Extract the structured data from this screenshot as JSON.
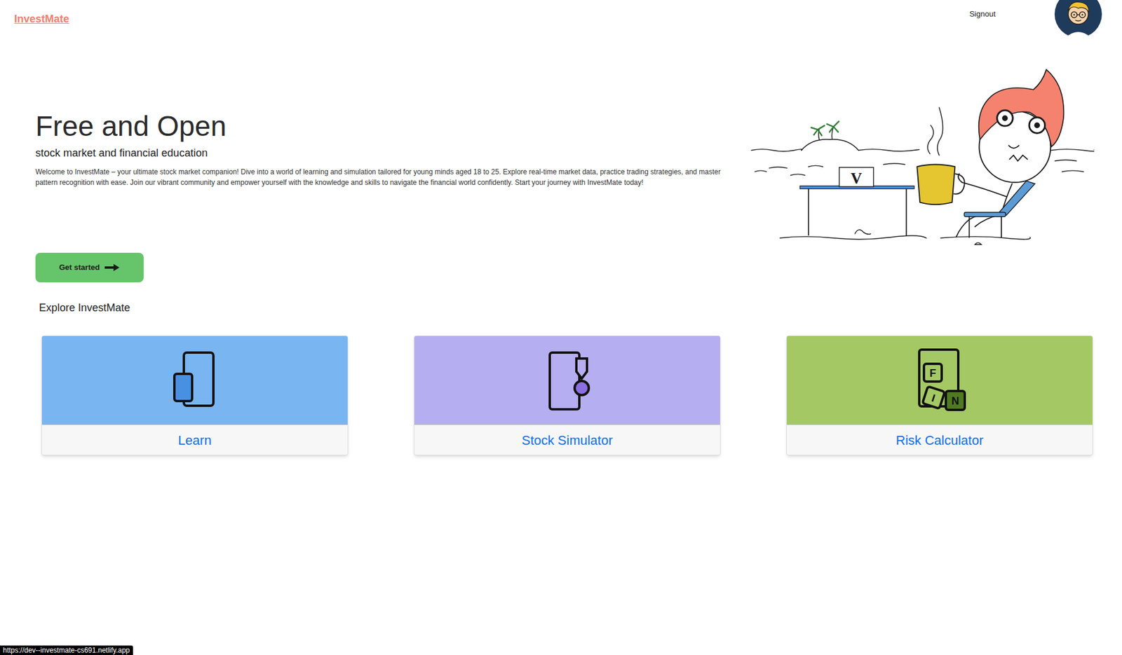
{
  "header": {
    "logo": "InvestMate",
    "signout": "Signout"
  },
  "hero": {
    "title": "Free and Open",
    "subtitle": "stock market and financial education",
    "description": "Welcome to InvestMate – your ultimate stock market companion! Dive into a world of learning and simulation tailored for young minds aged 18 to 25. Explore real-time market data, practice trading strategies, and master pattern recognition with ease. Join our vibrant community and empower yourself with the knowledge and skills to navigate the financial world confidently. Start your journey with InvestMate today!",
    "cta": "Get started",
    "illustration": {
      "laptop_letter": "V"
    }
  },
  "explore": {
    "title": "Explore InvestMate",
    "cards": [
      {
        "label": "Learn",
        "kind": "learn",
        "color": "#79b5f0"
      },
      {
        "label": "Stock Simulator",
        "kind": "simulator",
        "color": "#b5aef0"
      },
      {
        "label": "Risk Calculator",
        "kind": "calculator",
        "color": "#a4c964",
        "icon_letters": [
          "F",
          "I",
          "N"
        ]
      }
    ]
  },
  "status_bar": {
    "url": "https://dev--investmate-cs691.netlify.app"
  }
}
